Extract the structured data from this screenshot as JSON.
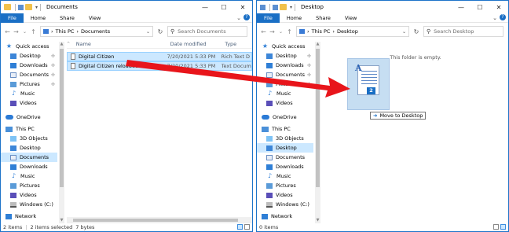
{
  "left_window": {
    "title": "Documents",
    "ribbon": [
      "File",
      "Home",
      "Share",
      "View"
    ],
    "breadcrumb": [
      "This PC",
      "Documents"
    ],
    "search_placeholder": "Search Documents",
    "nav": [
      {
        "label": "Quick access",
        "icon": "star-icon"
      },
      {
        "label": "Desktop",
        "icon": "desktop-icon",
        "pinned": true
      },
      {
        "label": "Downloads",
        "icon": "downloads-icon",
        "pinned": true
      },
      {
        "label": "Documents",
        "icon": "documents-icon",
        "pinned": true
      },
      {
        "label": "Pictures",
        "icon": "pictures-icon",
        "pinned": true
      },
      {
        "label": "Music",
        "icon": "music-icon"
      },
      {
        "label": "Videos",
        "icon": "videos-icon"
      },
      {
        "label": "OneDrive",
        "icon": "onedrive-icon"
      },
      {
        "label": "This PC",
        "icon": "this-pc-icon"
      },
      {
        "label": "3D Objects",
        "icon": "3d-objects-icon"
      },
      {
        "label": "Desktop",
        "icon": "desktop-icon"
      },
      {
        "label": "Documents",
        "icon": "documents-icon",
        "selected": true
      },
      {
        "label": "Downloads",
        "icon": "downloads-icon"
      },
      {
        "label": "Music",
        "icon": "music-icon"
      },
      {
        "label": "Pictures",
        "icon": "pictures-icon"
      },
      {
        "label": "Videos",
        "icon": "videos-icon"
      },
      {
        "label": "Windows (C:)",
        "icon": "drive-icon"
      },
      {
        "label": "Network",
        "icon": "network-icon"
      }
    ],
    "columns": {
      "name": "Name",
      "date": "Date modified",
      "type": "Type"
    },
    "files": [
      {
        "name": "Digital Citizen",
        "date": "7/20/2021 5:33 PM",
        "type": "Rich Text D"
      },
      {
        "name": "Digital Citizen reloaded",
        "date": "7/20/2021 5:33 PM",
        "type": "Text Docum"
      }
    ],
    "status": {
      "count": "2 items",
      "selected": "2 items selected",
      "size": "7 bytes"
    }
  },
  "right_window": {
    "title": "Desktop",
    "ribbon": [
      "File",
      "Home",
      "Share",
      "View"
    ],
    "breadcrumb": [
      "This PC",
      "Desktop"
    ],
    "search_placeholder": "Search Desktop",
    "empty_text": "This folder is empty.",
    "nav": [
      {
        "label": "Quick access",
        "icon": "star-icon"
      },
      {
        "label": "Desktop",
        "icon": "desktop-icon",
        "pinned": true
      },
      {
        "label": "Downloads",
        "icon": "downloads-icon",
        "pinned": true
      },
      {
        "label": "Documents",
        "icon": "documents-icon",
        "pinned": true
      },
      {
        "label": "Pictures",
        "icon": "pictures-icon",
        "pinned": true
      },
      {
        "label": "Music",
        "icon": "music-icon"
      },
      {
        "label": "Videos",
        "icon": "videos-icon"
      },
      {
        "label": "OneDrive",
        "icon": "onedrive-icon"
      },
      {
        "label": "This PC",
        "icon": "this-pc-icon"
      },
      {
        "label": "3D Objects",
        "icon": "3d-objects-icon"
      },
      {
        "label": "Desktop",
        "icon": "desktop-icon",
        "selected": true
      },
      {
        "label": "Documents",
        "icon": "documents-icon"
      },
      {
        "label": "Downloads",
        "icon": "downloads-icon"
      },
      {
        "label": "Music",
        "icon": "music-icon"
      },
      {
        "label": "Pictures",
        "icon": "pictures-icon"
      },
      {
        "label": "Videos",
        "icon": "videos-icon"
      },
      {
        "label": "Windows (C:)",
        "icon": "drive-icon"
      },
      {
        "label": "Network",
        "icon": "network-icon"
      }
    ],
    "status": {
      "count": "0 items"
    }
  },
  "drag": {
    "tooltip": "Move to Desktop",
    "badge": "2",
    "icon": "rich-text-document-icon"
  },
  "colors": {
    "accent": "#1a6fc5",
    "selection": "#cce8ff",
    "arrow": "#e8151b"
  }
}
